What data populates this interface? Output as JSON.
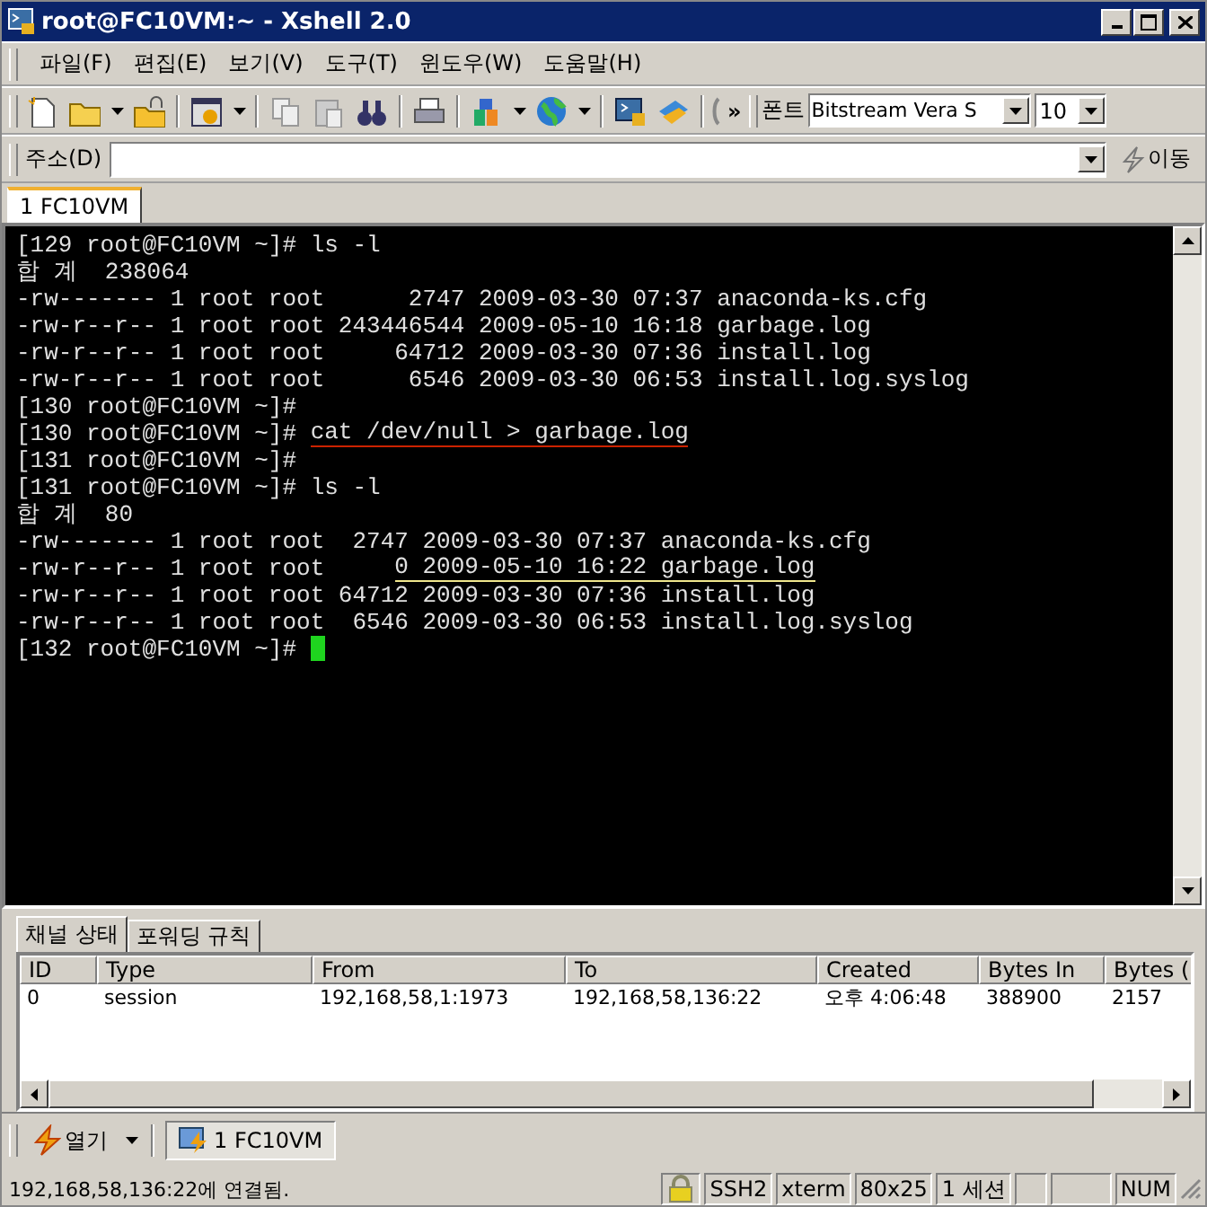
{
  "window": {
    "title": "root@FC10VM:~ - Xshell 2.0"
  },
  "menu": [
    {
      "label": "파일(F)"
    },
    {
      "label": "편집(E)"
    },
    {
      "label": "보기(V)"
    },
    {
      "label": "도구(T)"
    },
    {
      "label": "윈도우(W)"
    },
    {
      "label": "도움말(H)"
    }
  ],
  "toolbar": {
    "more": "»",
    "font_label": "폰트",
    "font_name": "Bitstream Vera S",
    "font_size": "10"
  },
  "address_bar": {
    "label": "주소(D)",
    "go_button": "이동"
  },
  "session_tabs": [
    {
      "label": "1 FC10VM",
      "selected": true
    }
  ],
  "terminal": {
    "lines": [
      [
        {
          "text": "[129 root@FC10VM ~]# ls -l"
        }
      ],
      [
        {
          "text": "합 계  238064"
        }
      ],
      [
        {
          "text": "-rw------- 1 root root      2747 2009-03-30 07:37 anaconda-ks.cfg"
        }
      ],
      [
        {
          "text": "-rw-r--r-- 1 root root 243446544 2009-05-10 16:18 garbage.log"
        }
      ],
      [
        {
          "text": "-rw-r--r-- 1 root root     64712 2009-03-30 07:36 install.log"
        }
      ],
      [
        {
          "text": "-rw-r--r-- 1 root root      6546 2009-03-30 06:53 install.log.syslog"
        }
      ],
      [
        {
          "text": "[130 root@FC10VM ~]#"
        }
      ],
      [
        {
          "text": "[130 root@FC10VM ~]# "
        },
        {
          "kind": "underlined",
          "text": "cat /dev/null > garbage.log",
          "color": "#cc2200"
        }
      ],
      [
        {
          "text": "[131 root@FC10VM ~]#"
        }
      ],
      [
        {
          "text": "[131 root@FC10VM ~]# ls -l"
        }
      ],
      [
        {
          "text": "합 계  80"
        }
      ],
      [
        {
          "text": "-rw------- 1 root root  2747 2009-03-30 07:37 anaconda-ks.cfg"
        }
      ],
      [
        {
          "text": "-rw-r--r-- 1 root root     "
        },
        {
          "kind": "underlined",
          "text": "0 2009-05-10 16:22 garbage.log",
          "color": "#f0e68c"
        }
      ],
      [
        {
          "text": "-rw-r--r-- 1 root root 64712 2009-03-30 07:36 install.log"
        }
      ],
      [
        {
          "text": "-rw-r--r-- 1 root root  6546 2009-03-30 06:53 install.log.syslog"
        }
      ],
      [
        {
          "text": "[132 root@FC10VM ~]# "
        },
        {
          "kind": "cursor"
        }
      ]
    ]
  },
  "panel": {
    "tabs": [
      {
        "label": "채널 상태",
        "selected": true
      },
      {
        "label": "포워딩 규칙",
        "selected": false
      }
    ],
    "table": {
      "columns": [
        "ID",
        "Type",
        "From",
        "To",
        "Created",
        "Bytes In",
        "Bytes ("
      ],
      "rows": [
        [
          "0",
          "session",
          "192,168,58,1:1973",
          "192,168,58,136:22",
          "오후 4:06:48",
          "388900",
          "2157"
        ]
      ]
    }
  },
  "taskbar": {
    "open_button": "열기",
    "sessions": [
      {
        "label": "1 FC10VM",
        "selected": true
      }
    ]
  },
  "status_bar": {
    "message": "192,168,58,136:22에 연결됨.",
    "fields": [
      "SSH2",
      "xterm",
      "80x25",
      "1 세션"
    ],
    "num_indicator": "NUM"
  }
}
